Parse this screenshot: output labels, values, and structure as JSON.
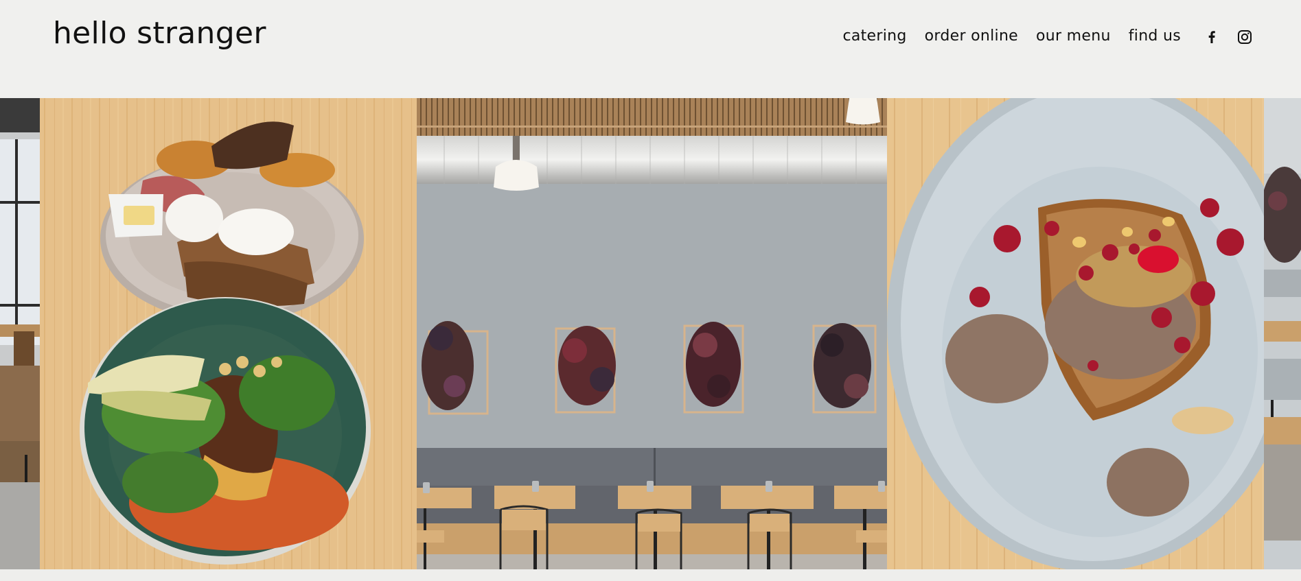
{
  "brand": {
    "name": "hello stranger"
  },
  "nav": {
    "items": [
      {
        "label": "catering"
      },
      {
        "label": "order online"
      },
      {
        "label": "our menu"
      },
      {
        "label": "find us"
      }
    ]
  },
  "social": {
    "icons": [
      "facebook-icon",
      "instagram-icon"
    ]
  },
  "gallery": {
    "slides": [
      {
        "name": "cafe-interior-partial-left"
      },
      {
        "name": "breakfast-plate-and-salad-bowl"
      },
      {
        "name": "dining-room-with-dried-flower-frames"
      },
      {
        "name": "french-toast-with-crumble"
      },
      {
        "name": "cafe-interior-partial-right"
      }
    ]
  },
  "colors": {
    "background": "#f0f0ee",
    "text": "#111111"
  }
}
